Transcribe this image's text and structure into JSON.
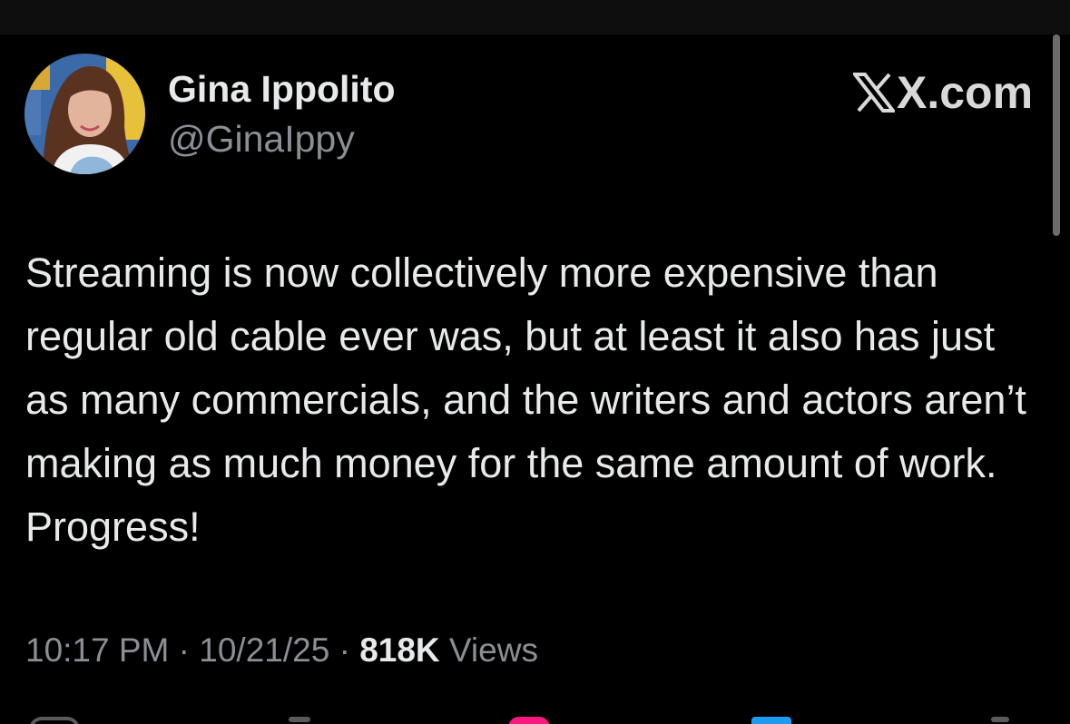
{
  "author": {
    "display_name": "Gina Ippolito",
    "handle": "@GinaIppy"
  },
  "brand": {
    "domain": "X.com"
  },
  "tweet": {
    "text": "Streaming is now collectively more expensive than regular old cable ever was, but at least it also has just as many commercials, and the writers and actors aren’t making as much money for the same amount of work. Progress!",
    "time": "10:17 PM",
    "separator": "·",
    "date": "10/21/25",
    "views_count": "818K",
    "views_label": "Views"
  },
  "icons": {
    "reply": "reply-icon",
    "retweet": "retweet-icon",
    "like": "heart-icon",
    "bookmark": "bookmark-icon",
    "share": "share-icon"
  },
  "colors": {
    "background": "#000000",
    "text_primary": "#e7e9ea",
    "text_secondary": "#8b8f94",
    "like_pink": "#f91880",
    "bookmark_blue": "#1d9bf0"
  }
}
